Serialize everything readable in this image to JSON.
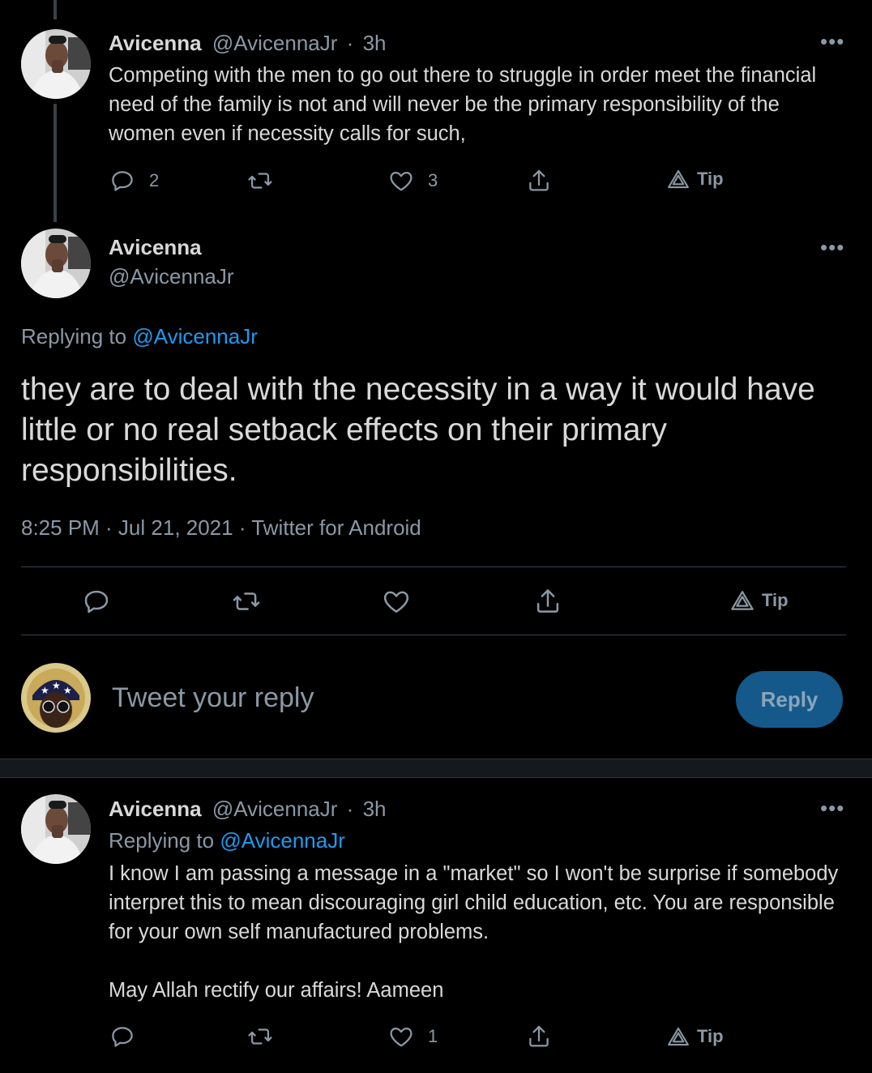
{
  "tweet1": {
    "name": "Avicenna",
    "handle": "@AvicennaJr",
    "dot": "·",
    "time": "3h",
    "text": "Competing with the men to go out there to struggle in order meet the financial need of the family is not and will never be the primary responsibility of the women even if necessity calls for such,",
    "replies": "2",
    "likes": "3",
    "tip": "Tip",
    "more": "•••"
  },
  "main_tweet": {
    "name": "Avicenna",
    "handle": "@AvicennaJr",
    "replying_prefix": "Replying to",
    "replying_handle": "@AvicennaJr",
    "text": "they are to deal with the necessity in a way it would have little or no real setback effects on their primary responsibilities.",
    "timestamp": "8:25 PM · Jul 21, 2021 · Twitter for Android",
    "tip": "Tip",
    "more": "•••"
  },
  "composer": {
    "placeholder": "Tweet your reply",
    "button": "Reply"
  },
  "tweet3": {
    "name": "Avicenna",
    "handle": "@AvicennaJr",
    "dot": "·",
    "time": "3h",
    "replying_prefix": "Replying to",
    "replying_handle": "@AvicennaJr",
    "text_p1": "I know I am passing a message in a \"market\" so I won't be surprise if somebody interpret this to mean discouraging girl child education, etc. You are responsible for your own self manufactured problems.",
    "text_p2": "May Allah rectify our affairs! Aameen",
    "likes": "1",
    "tip": "Tip",
    "more": "•••"
  },
  "colors": {
    "background": "#000000",
    "text": "#d9d9d9",
    "secondary": "#8b98a5",
    "link": "#1d9bf0",
    "reply_button": "#15588a"
  },
  "icons": [
    "reply-icon",
    "retweet-icon",
    "like-icon",
    "share-icon",
    "tip-icon",
    "more-icon"
  ]
}
